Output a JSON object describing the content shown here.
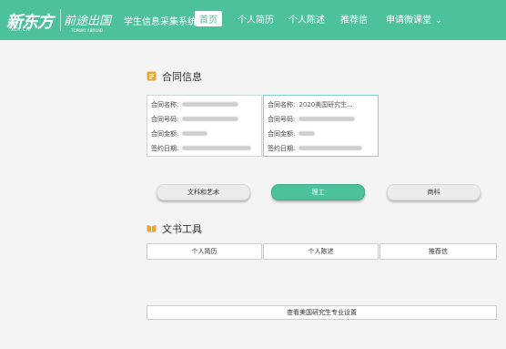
{
  "header": {
    "logo_text": "新东方",
    "logo_sub": "XDF.CN",
    "partner_text": "前途出国",
    "partner_sub": "TOPWAY ABROAD",
    "system_title": "学生信息采集系统",
    "nav": [
      {
        "label": "首页",
        "active": true
      },
      {
        "label": "个人简历",
        "active": false
      },
      {
        "label": "个人陈述",
        "active": false
      },
      {
        "label": "推荐信",
        "active": false
      },
      {
        "label": "申请微课堂",
        "active": false
      }
    ],
    "accent_color": "#4dc09c"
  },
  "contracts": {
    "title": "合同信息",
    "labels": {
      "name": "合同名称:",
      "number": "合同号码:",
      "amount": "合同金额:",
      "date": "签约日期:"
    },
    "cards": [
      {
        "name_value": "",
        "selected": false
      },
      {
        "name_value": "2020美国研究生...",
        "selected": true
      }
    ]
  },
  "categories": {
    "options": [
      {
        "label": "文科和艺术",
        "active": false
      },
      {
        "label": "理工",
        "active": true
      },
      {
        "label": "商科",
        "active": false
      }
    ]
  },
  "tools": {
    "title": "文书工具",
    "buttons": [
      "个人简历",
      "个人陈述",
      "推荐信"
    ],
    "setting_button": "查看美国研究生专业设置"
  }
}
